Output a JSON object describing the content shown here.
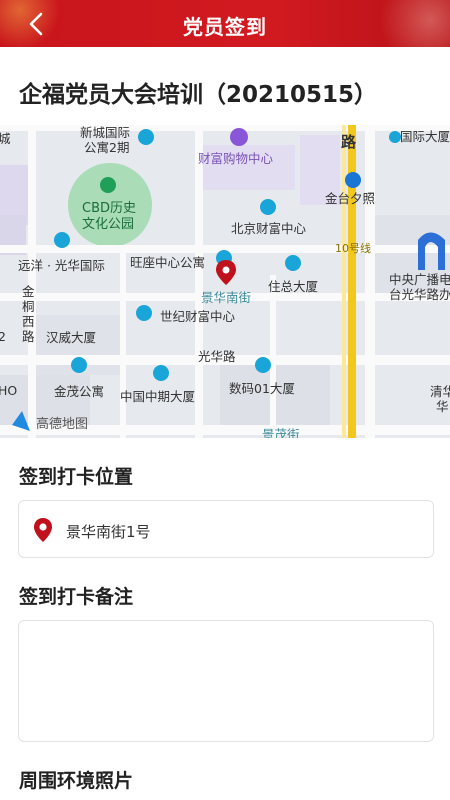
{
  "header": {
    "title": "党员签到",
    "back_icon": "chevron-left-icon"
  },
  "event": {
    "title": "企福党员大会培训（20210515）"
  },
  "map": {
    "provider": "高德地图",
    "labels": {
      "cheng": "城",
      "xincheng": "新城国际",
      "gongyu2": "公寓2期",
      "caifu_gouwu": "财富购物中心",
      "road_lu": "路",
      "guoji_dasha": "国际大厦",
      "cbd_park_1": "CBD历史",
      "cbd_park_2": "文化公园",
      "jintai": "金台夕照",
      "beijing_caifu": "北京财富中心",
      "line10": "10号线",
      "yuanyang": "远洋 · 光华国际",
      "wangzuo": "旺座中心公寓",
      "zhuzong": "住总大厦",
      "jinghua_nanjie": "景华南街",
      "jintong_1": "金",
      "jintong_2": "桐",
      "jintong_3": "西",
      "jintong_4": "路",
      "cctv_1": "中央广播电",
      "cctv_2": "台光华路办",
      "shiji": "世纪财富中心",
      "hanwei": "汉威大厦",
      "num2": "2",
      "guanghua_lu": "光华路",
      "ho": "HO",
      "jinmao": "金茂公寓",
      "zhongguo_zhongqi": "中国中期大厦",
      "shuma": "数码01大厦",
      "qinghua_1": "清华",
      "qinghua_2": "华",
      "jingmao": "景茂街"
    }
  },
  "checkin_location": {
    "label": "签到打卡位置",
    "value": "景华南街1号",
    "icon": "location-pin-icon"
  },
  "checkin_remark": {
    "label": "签到打卡备注",
    "value": "",
    "placeholder": ""
  },
  "photos": {
    "label": "周围环境照片"
  },
  "colors": {
    "primary": "#c8141c",
    "pin": "#c0121c",
    "poi": "#1aa5d8",
    "metro": "#f2c81e"
  }
}
